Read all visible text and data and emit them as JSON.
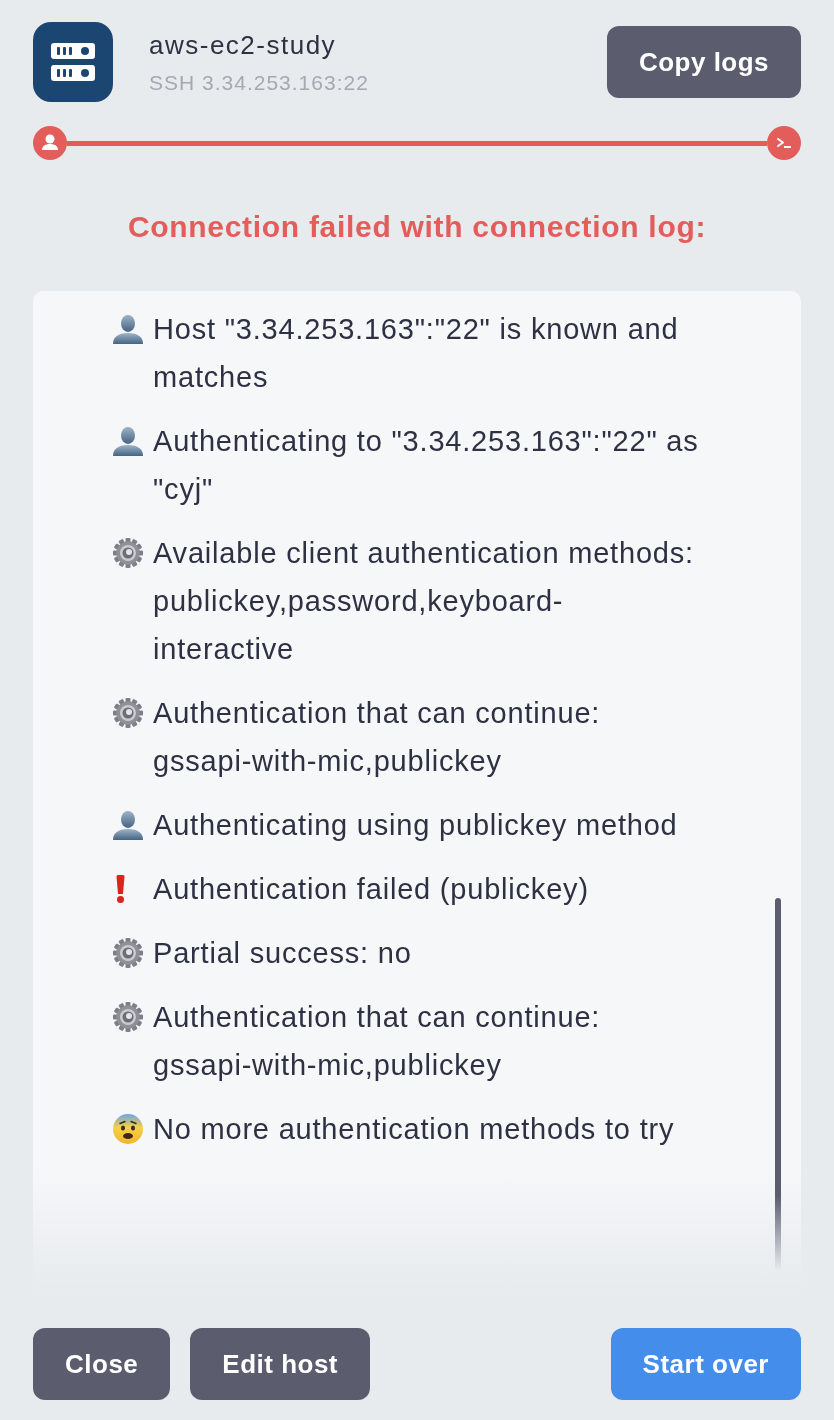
{
  "host": {
    "name": "aws-ec2-study",
    "address": "SSH 3.34.253.163:22"
  },
  "copy_button": "Copy logs",
  "connection": {
    "failed": true
  },
  "heading": "Connection failed with connection log:",
  "log": [
    {
      "kind": "user",
      "text": "Host \"3.34.253.163\":\"22\" is known and matches"
    },
    {
      "kind": "user",
      "text": "Authenticating to \"3.34.253.163\":\"22\" as \"cyj\""
    },
    {
      "kind": "system",
      "text": "Available client authentication methods: publickey,password,keyboard-interactive"
    },
    {
      "kind": "system",
      "text": "Authentication that can continue: gssapi-with-mic,publickey"
    },
    {
      "kind": "user",
      "text": "Authenticating using publickey method"
    },
    {
      "kind": "error",
      "text": "Authentication failed (publickey)"
    },
    {
      "kind": "system",
      "text": "Partial success: no"
    },
    {
      "kind": "system",
      "text": "Authentication that can continue: gssapi-with-mic,publickey"
    },
    {
      "kind": "fatal",
      "text": "No more authentication methods to try"
    }
  ],
  "buttons": [
    {
      "label": "Close",
      "kind": "secondary"
    },
    {
      "label": "Edit host",
      "kind": "secondary"
    },
    {
      "label": "Start over",
      "kind": "primary"
    }
  ]
}
